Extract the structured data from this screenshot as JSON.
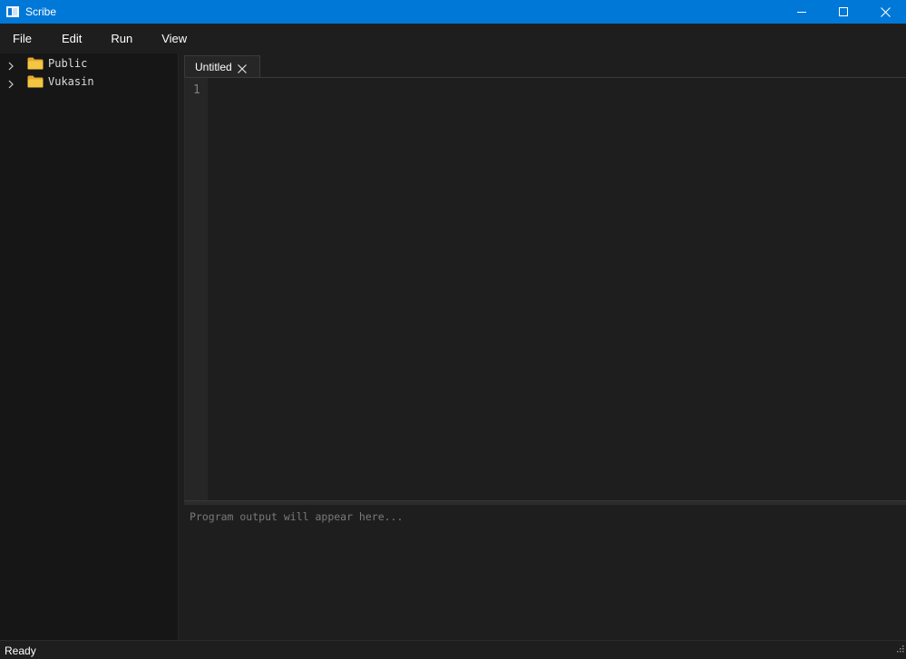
{
  "window": {
    "title": "Scribe",
    "icon": "app-window-icon",
    "controls": [
      "minimize-icon",
      "maximize-icon",
      "close-icon"
    ],
    "accent_color": "#0078d7"
  },
  "menu": {
    "file": "File",
    "edit": "Edit",
    "run": "Run",
    "view": "View"
  },
  "sidebar": {
    "items": [
      {
        "label": "Public",
        "icon": "folder-icon",
        "expander": "chevron-right-icon"
      },
      {
        "label": "Vukasin",
        "icon": "folder-icon",
        "expander": "chevron-right-icon"
      }
    ],
    "folder_color": "#f4c542"
  },
  "editor": {
    "tabs": [
      {
        "label": "Untitled",
        "close_icon": "close-icon"
      }
    ],
    "line_numbers": [
      "1"
    ]
  },
  "output": {
    "placeholder": "Program output will appear here..."
  },
  "status": {
    "text": "Ready"
  }
}
